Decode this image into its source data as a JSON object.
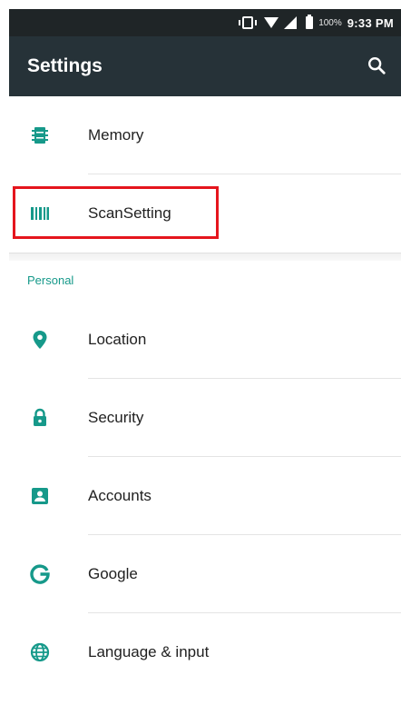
{
  "status_bar": {
    "battery_percent": "100%",
    "time": "9:33 PM"
  },
  "toolbar": {
    "title": "Settings",
    "search_icon": "search-icon"
  },
  "items_top": [
    {
      "label": "Memory",
      "icon": "memory-icon"
    },
    {
      "label": "ScanSetting",
      "icon": "barcode-icon"
    }
  ],
  "section": {
    "header": "Personal"
  },
  "items_personal": [
    {
      "label": "Location",
      "icon": "location-pin-icon"
    },
    {
      "label": "Security",
      "icon": "lock-icon"
    },
    {
      "label": "Accounts",
      "icon": "account-icon"
    },
    {
      "label": "Google",
      "icon": "google-icon"
    },
    {
      "label": "Language & input",
      "icon": "globe-icon"
    }
  ],
  "colors": {
    "accent": "#16998a",
    "toolbar": "#263238",
    "statusbar": "#1f2527",
    "highlight": "#e5151d"
  }
}
